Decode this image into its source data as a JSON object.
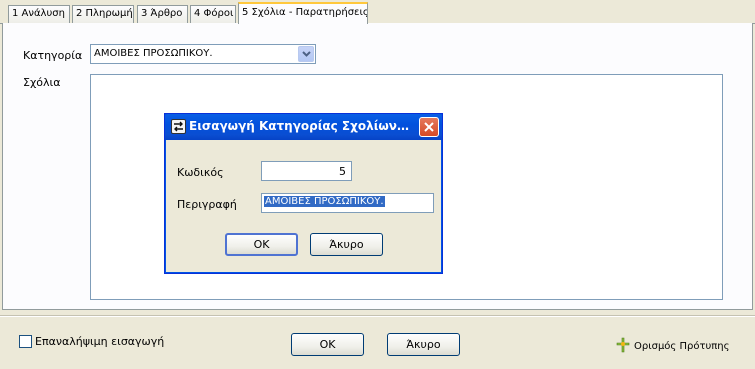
{
  "tabs": [
    {
      "label": "1 Ανάλυση"
    },
    {
      "label": "2 Πληρωμή"
    },
    {
      "label": "3 Άρθρο"
    },
    {
      "label": "4 Φόροι"
    },
    {
      "label": "5 Σχόλια - Παρατηρήσεις",
      "active": true
    }
  ],
  "form": {
    "category_label": "Κατηγορία",
    "category_value": "ΑΜΟΙΒΕΣ ΠΡΟΣΩΠΙΚΟΥ.",
    "notes_label": "Σχόλια"
  },
  "dialog": {
    "title": "Εισαγωγή Κατηγορίας Σχολίων Εγγραφών",
    "code_label": "Κωδικός",
    "code_value": "5",
    "description_label": "Περιγραφή",
    "description_value": "ΑΜΟΙΒΕΣ ΠΡΟΣΩΠΙΚΟΥ.",
    "ok_label": "OK",
    "cancel_label": "Άκυρο"
  },
  "bottom": {
    "repeat_label": "Επαναλήψιμη εισαγωγή",
    "repeat_checked": false,
    "ok_label": "OK",
    "cancel_label": "Άκυρο",
    "template_label": "Ορισμός Πρότυπης"
  },
  "icons": {
    "dropdown": "chevron-down-icon",
    "dialog_app": "transfer-arrows-icon",
    "close": "close-icon",
    "template": "pin-icon"
  }
}
